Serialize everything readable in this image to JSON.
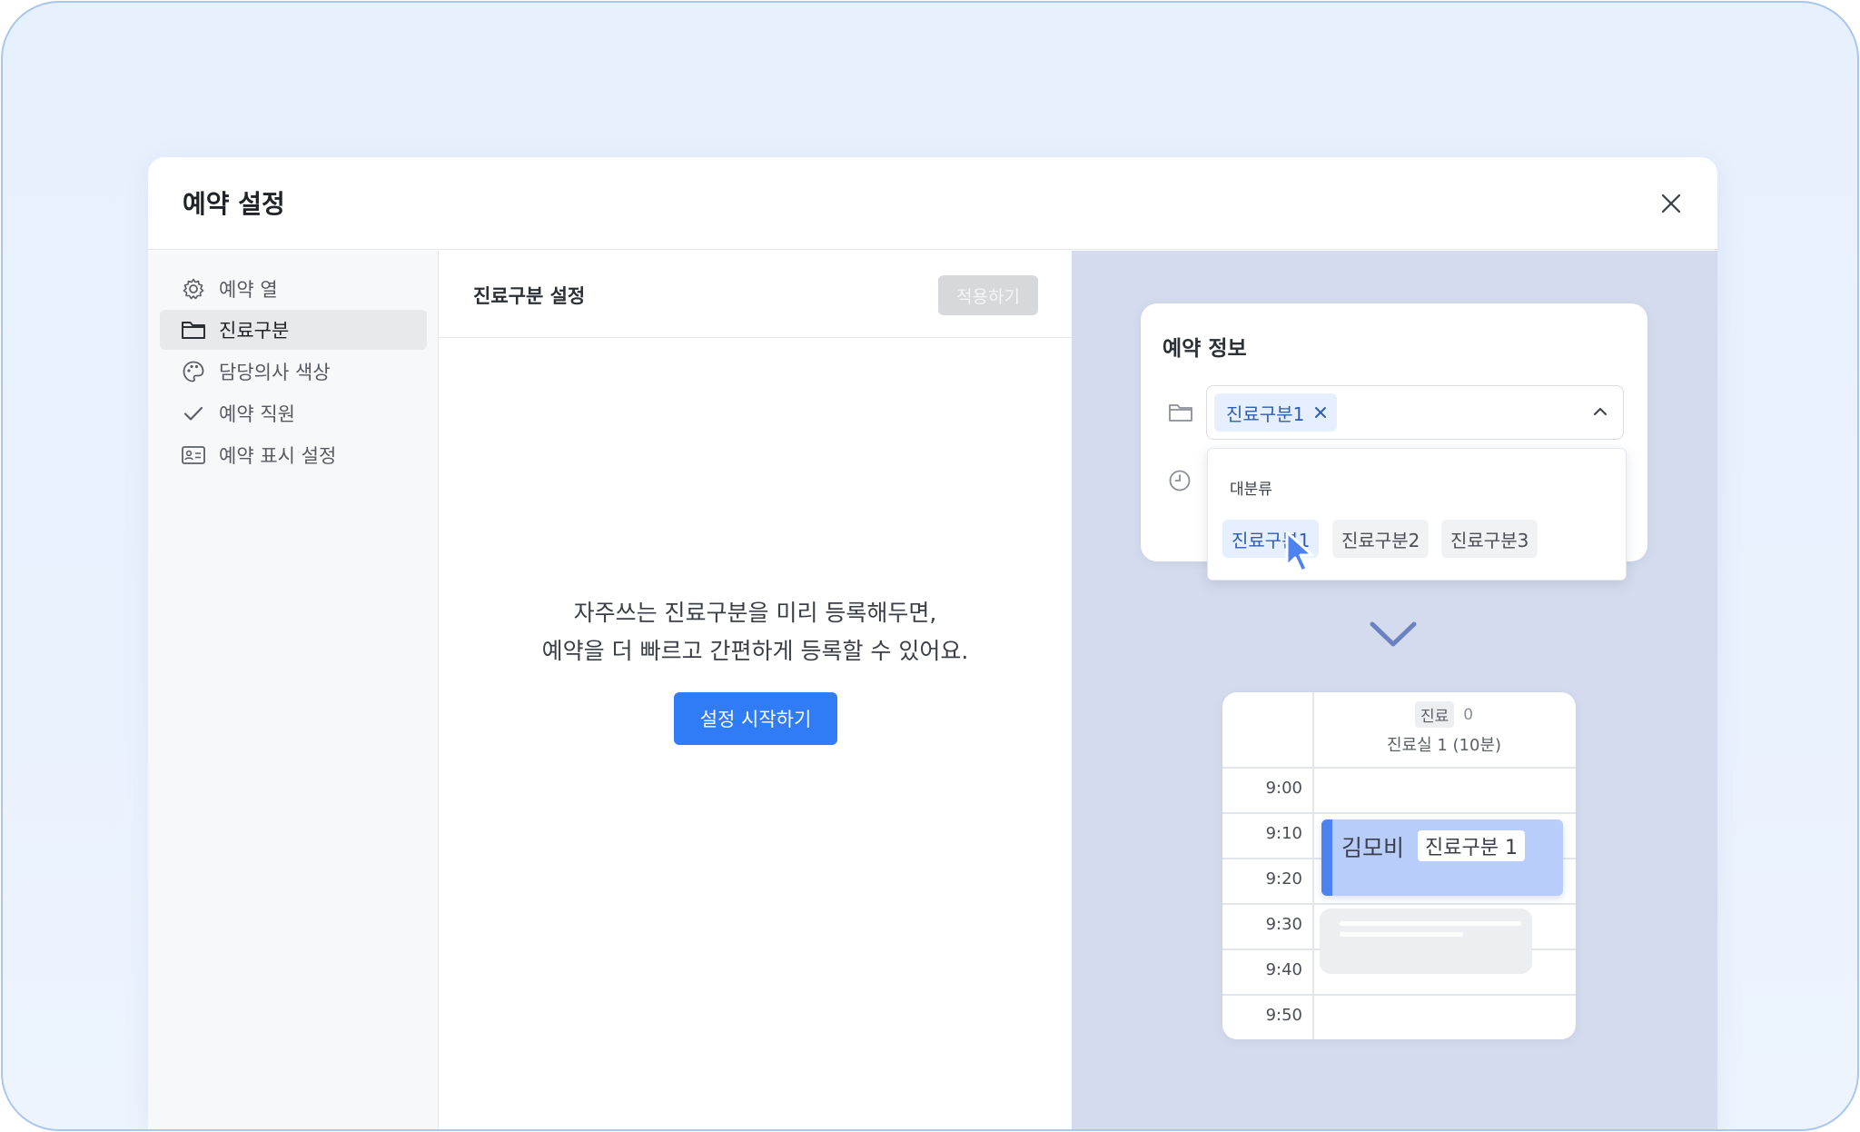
{
  "dialog": {
    "title": "예약 설정"
  },
  "sidebar": {
    "items": [
      {
        "label": "예약 열",
        "icon": "gear-icon"
      },
      {
        "label": "진료구분",
        "icon": "folder-icon",
        "active": true
      },
      {
        "label": "담당의사 색상",
        "icon": "palette-icon"
      },
      {
        "label": "예약 직원",
        "icon": "check-icon"
      },
      {
        "label": "예약 표시 설정",
        "icon": "id-card-icon"
      }
    ]
  },
  "main": {
    "title": "진료구분 설정",
    "apply_label": "적용하기",
    "empty_line1": "자주쓰는 진료구분을 미리 등록해두면,",
    "empty_line2": "예약을 더 빠르고 간편하게 등록할 수 있어요.",
    "start_label": "설정 시작하기"
  },
  "preview": {
    "card_title": "예약 정보",
    "selected_chip": "진료구분1",
    "dropdown": {
      "group_label": "대분류",
      "options": [
        "진료구분1",
        "진료구분2",
        "진료구분3"
      ],
      "selected_index": 0
    },
    "calendar": {
      "category_tag": "진료",
      "count": "0",
      "room": "진료실 1 (10분)",
      "times": [
        "9:00",
        "9:10",
        "9:20",
        "9:30",
        "9:40",
        "9:50"
      ],
      "appointment": {
        "name": "김모비",
        "tag": "진료구분 1"
      }
    }
  },
  "colors": {
    "primary": "#2f7cf6",
    "preview_bg": "#d4dbee",
    "chip_bg": "#e6efff",
    "chip_text": "#2f5db5",
    "appt_bg": "#b9cdfa",
    "appt_bar": "#4c83f1"
  }
}
